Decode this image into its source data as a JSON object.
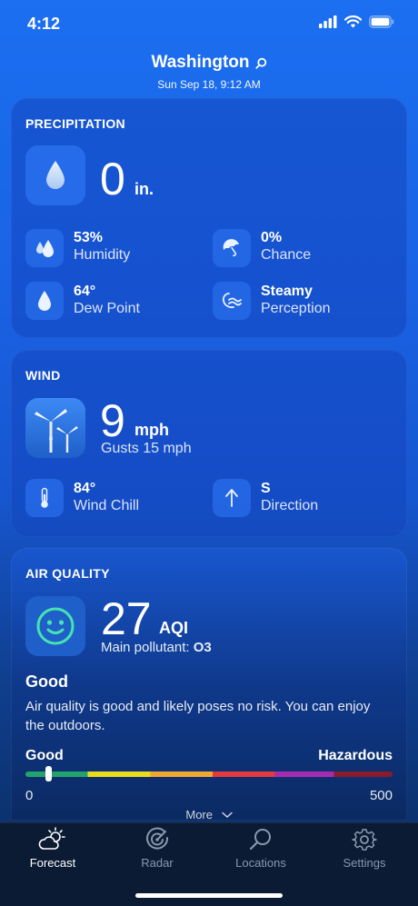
{
  "status": {
    "time": "4:12"
  },
  "header": {
    "city": "Washington",
    "date": "Sun Sep 18, 9:12 AM"
  },
  "precipitation": {
    "title": "PRECIPITATION",
    "value": "0",
    "unit": "in.",
    "metrics": [
      {
        "value": "53%",
        "label": "Humidity",
        "icon": "humidity-icon"
      },
      {
        "value": "0%",
        "label": "Chance",
        "icon": "umbrella-icon"
      },
      {
        "value": "64°",
        "label": "Dew Point",
        "icon": "drop-icon"
      },
      {
        "value": "Steamy",
        "label": "Perception",
        "icon": "wave-icon"
      }
    ]
  },
  "wind": {
    "title": "WIND",
    "value": "9",
    "unit": "mph",
    "gusts": "Gusts 15 mph",
    "metrics": [
      {
        "value": "84°",
        "label": "Wind Chill",
        "icon": "thermometer-icon"
      },
      {
        "value": "S",
        "label": "Direction",
        "icon": "arrow-up-icon"
      }
    ]
  },
  "air_quality": {
    "title": "AIR QUALITY",
    "value": "27",
    "unit": "AQI",
    "pollutant": "Main pollutant: ",
    "pollutant_value": "O3",
    "level": "Good",
    "description": "Air quality is good and likely poses no risk. You can enjoy the outdoors.",
    "scale_low_label": "Good",
    "scale_high_label": "Hazardous",
    "scale_min": "0",
    "scale_max": "500",
    "aqi_fraction": 0.054,
    "more": "More"
  },
  "tabs": [
    {
      "label": "Forecast",
      "active": true,
      "icon": "forecast-icon"
    },
    {
      "label": "Radar",
      "active": false,
      "icon": "radar-icon"
    },
    {
      "label": "Locations",
      "active": false,
      "icon": "search-icon"
    },
    {
      "label": "Settings",
      "active": false,
      "icon": "gear-icon"
    }
  ],
  "colors": {
    "accent": "#1a63e6",
    "tabbar": "#0b1b33",
    "inactive_tab": "#8a98ad"
  }
}
